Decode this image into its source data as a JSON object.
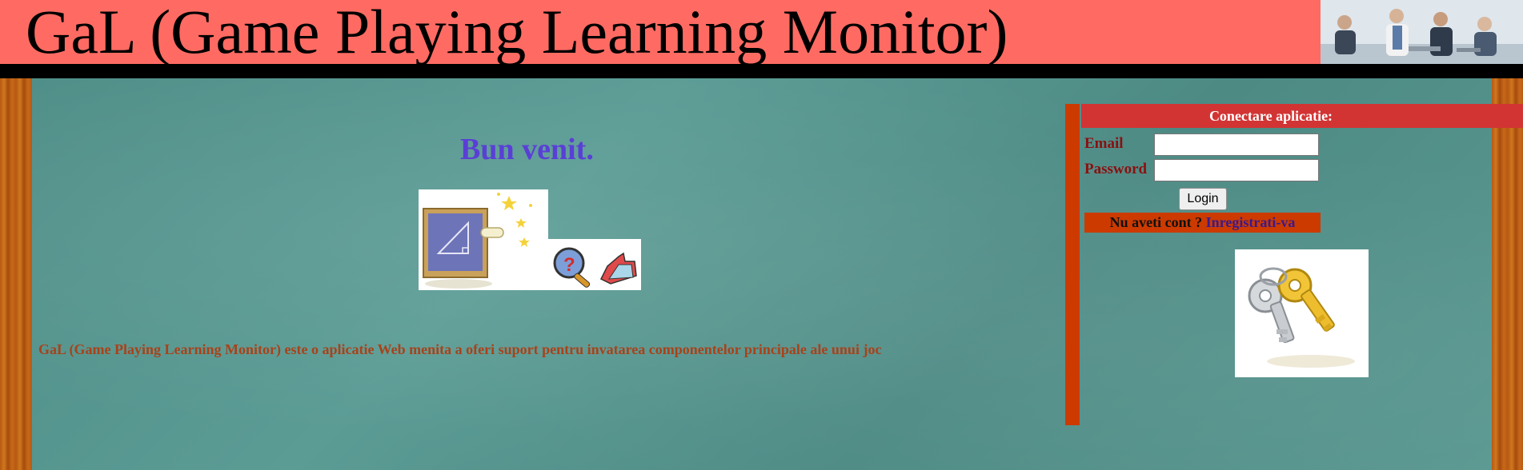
{
  "header": {
    "title": "GaL (Game Playing Learning Monitor)"
  },
  "main": {
    "welcome": "Bun venit.",
    "description": "GaL (Game Playing Learning Monitor) este o aplicatie Web menita a oferi suport pentru invatarea componentelor principale ale unui joc"
  },
  "login": {
    "title": "Conectare aplicatie:",
    "email_label": "Email",
    "email_value": "",
    "password_label": "Password",
    "password_value": "",
    "button_label": "Login",
    "register_prompt": "Nu aveti cont ?",
    "register_link": "Inregistrati-va"
  },
  "icons": {
    "illustration": "chalkboard-question-thumbs-icon",
    "keys": "keys-icon"
  },
  "colors": {
    "header_bg": "#ff6b63",
    "welcome": "#5a3fd6",
    "description": "#a8421a",
    "login_header": "#d23434",
    "accent_bar": "#cc3a00"
  }
}
